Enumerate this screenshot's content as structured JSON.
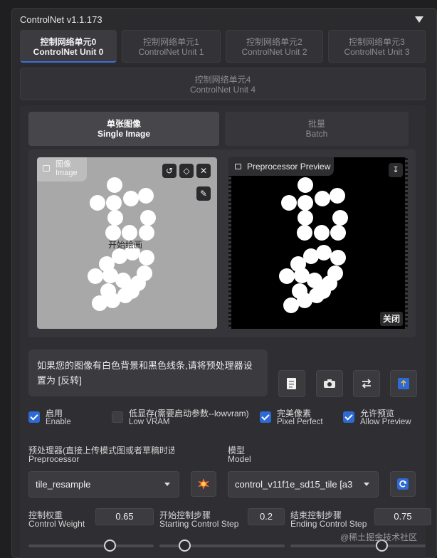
{
  "header": {
    "title": "ControlNet v1.1.173"
  },
  "unit_tabs": [
    {
      "cn": "控制网络单元0",
      "en": "ControlNet Unit 0"
    },
    {
      "cn": "控制网络单元1",
      "en": "ControlNet Unit 1"
    },
    {
      "cn": "控制网络单元2",
      "en": "ControlNet Unit 2"
    },
    {
      "cn": "控制网络单元3",
      "en": "ControlNet Unit 3"
    },
    {
      "cn": "控制网络单元4",
      "en": "ControlNet Unit 4"
    }
  ],
  "mode_tabs": {
    "single": {
      "cn": "单张图像",
      "en": "Single Image"
    },
    "batch": {
      "cn": "批量",
      "en": "Batch"
    }
  },
  "image_panel": {
    "label_cn": "图像",
    "label_en": "Image",
    "start_drawing": "开始绘画",
    "preview_label": "Preprocessor Preview",
    "close": "关闭"
  },
  "hint": "如果您的图像有白色背景和黑色线条,请将预处理器设置为 [反转]",
  "checkboxes": [
    {
      "cn": "启用",
      "en": "Enable",
      "checked": true
    },
    {
      "cn": "低显存(需要启动参数--lowvram)",
      "en": "Low VRAM",
      "checked": false
    },
    {
      "cn": "完美像素",
      "en": "Pixel Perfect",
      "checked": true
    },
    {
      "cn": "允许预览",
      "en": "Allow Preview",
      "checked": true
    }
  ],
  "preprocessor": {
    "label_cn": "预处理器(直接上传模式图或者草稿时选",
    "label_en": "Preprocessor",
    "value": "tile_resample"
  },
  "model": {
    "label_cn": "模型",
    "label_en": "Model",
    "value": "control_v11f1e_sd15_tile [a3"
  },
  "control_weight": {
    "label_cn": "控制权重",
    "label_en": "Control Weight",
    "value": "0.65",
    "fraction": 0.65
  },
  "starting_step": {
    "label_cn": "开始控制步骤",
    "label_en": "Starting Control Step",
    "value": "0.2",
    "fraction": 0.2
  },
  "ending_step": {
    "label_cn": "结束控制步骤",
    "label_en": "Ending Control Step",
    "value": "0.75",
    "fraction": 0.75
  },
  "watermark": "@稀土掘金技术社区",
  "icons": {
    "undo": "undo-icon",
    "eraser": "eraser-icon",
    "close": "close-icon",
    "brush": "brush-icon",
    "download": "download-icon",
    "image": "image-icon",
    "new_canvas": "new-canvas-icon",
    "camera": "camera-icon",
    "swap": "swap-icon",
    "send": "send-dimensions-icon",
    "explode": "run-preprocessor-icon",
    "refresh": "refresh-icon"
  },
  "colors": {
    "accent": "#2d6ad6",
    "panel": "#2f2f33"
  }
}
